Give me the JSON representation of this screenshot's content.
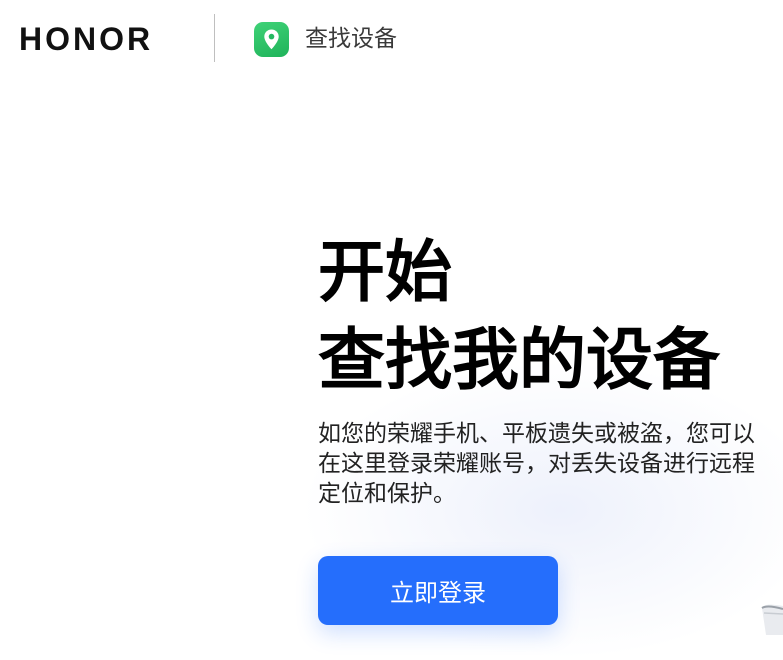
{
  "header": {
    "brand": "HONOR",
    "app_name": "查找设备",
    "app_icon": "location-pin-icon",
    "app_icon_color": "#2cc36b"
  },
  "hero": {
    "title_line1": "开始",
    "title_line2": "查找我的设备",
    "description": "如您的荣耀手机、平板遗失或被盗，您可以在这里登录荣耀账号，对丢失设备进行远程定位和保护。"
  },
  "actions": {
    "login_label": "立即登录",
    "login_color": "#256efc"
  }
}
